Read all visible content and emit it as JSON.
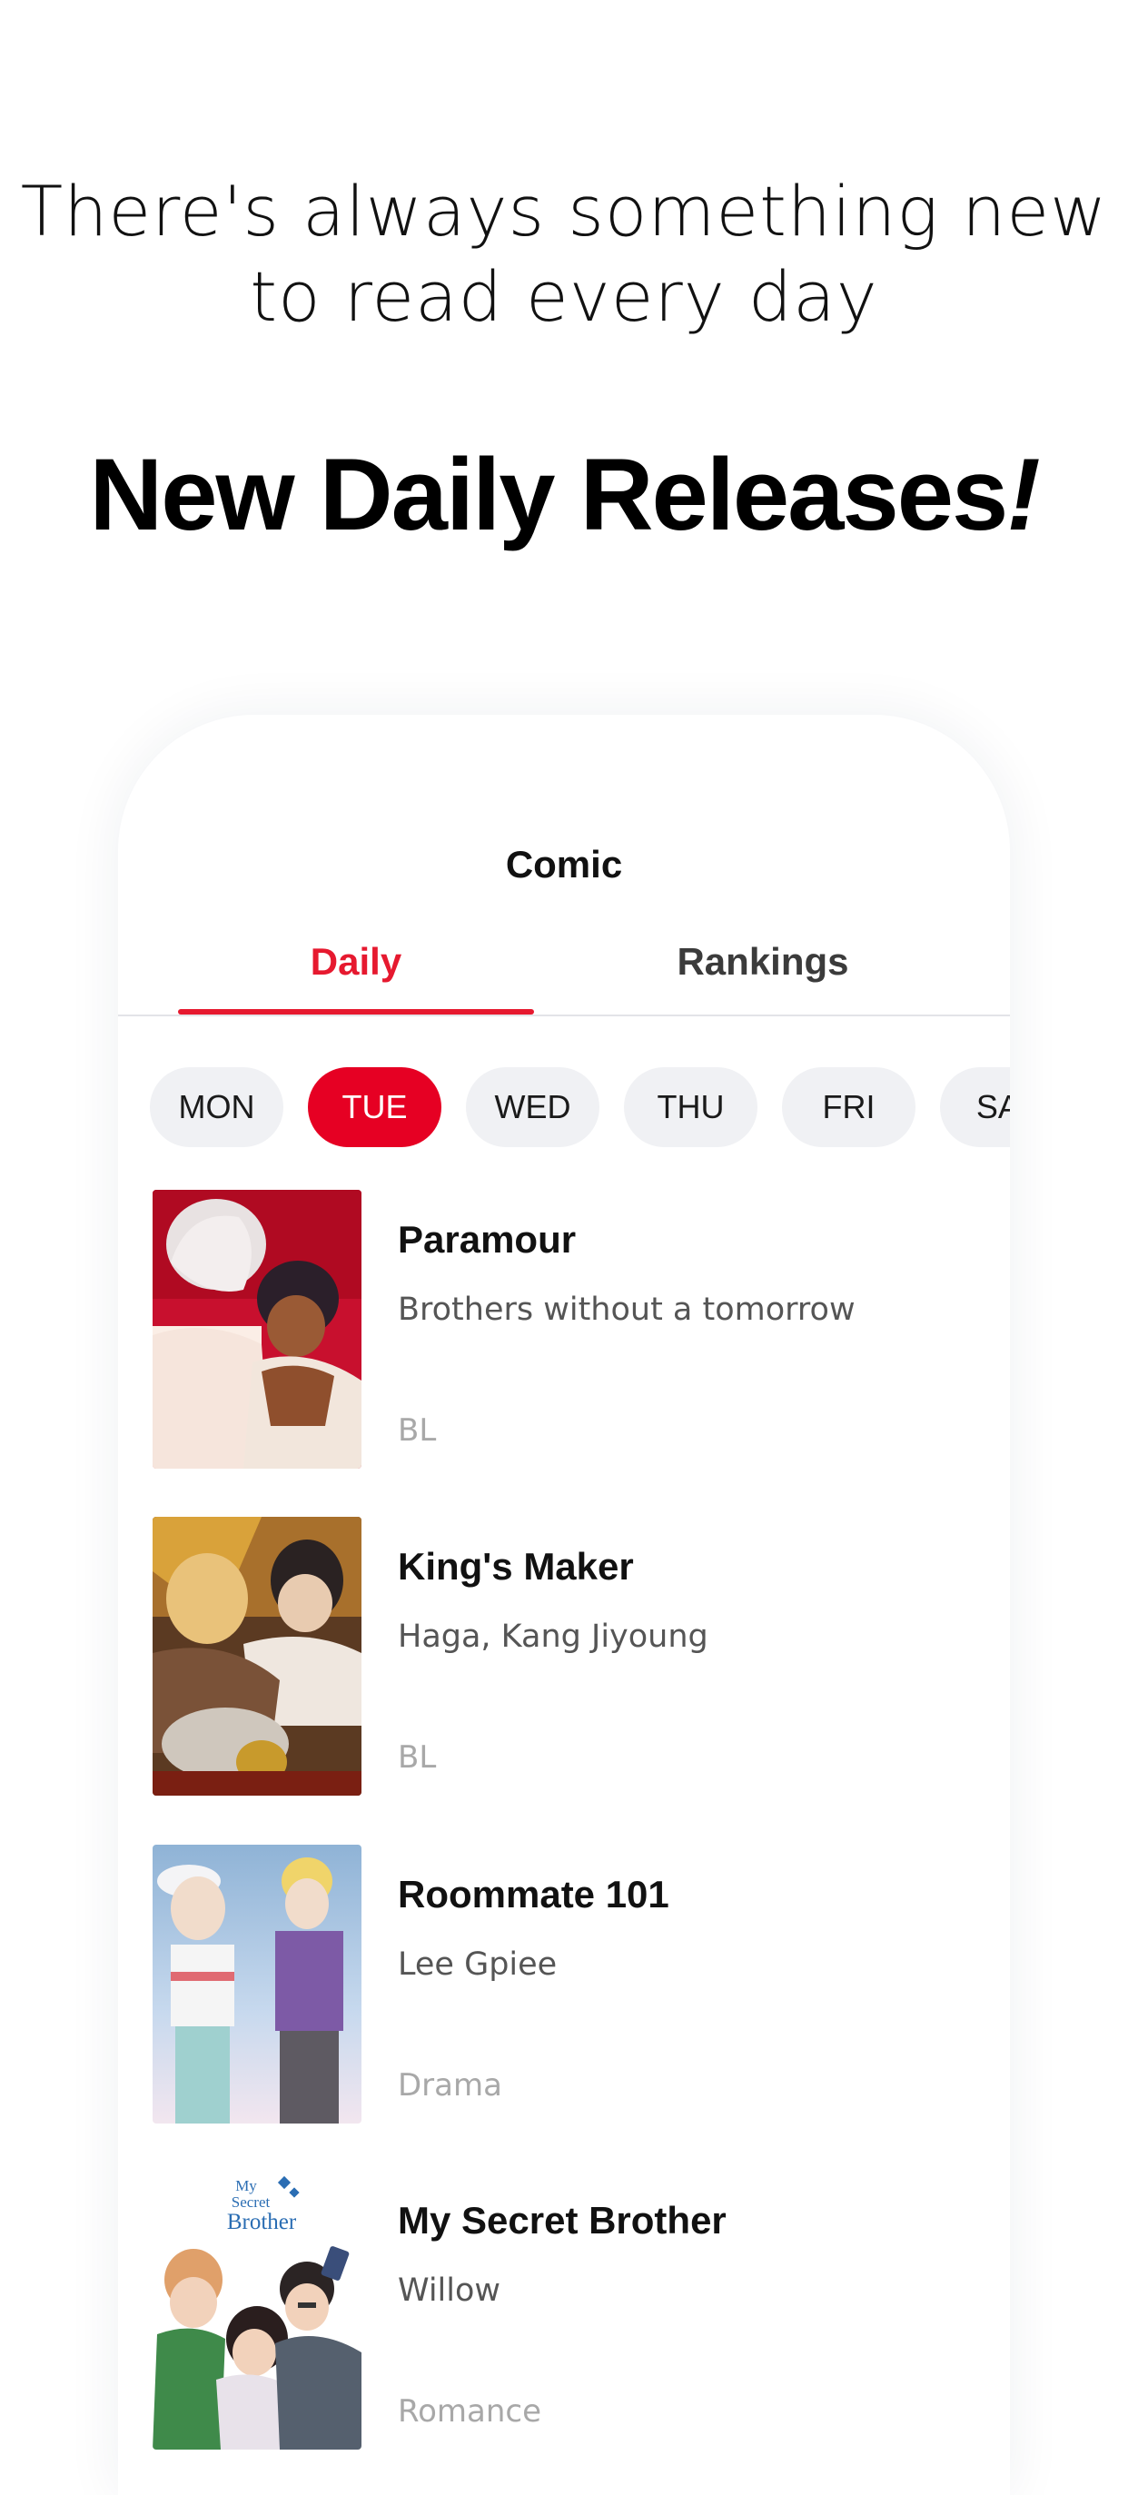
{
  "promo": {
    "subtitle": "There's always something new\nto read every day",
    "title_main": "New  Daily Releases",
    "title_bang": "!"
  },
  "screen": {
    "title": "Comic",
    "tabs": [
      {
        "label": "Daily",
        "active": true
      },
      {
        "label": "Rankings",
        "active": false
      }
    ],
    "days": [
      {
        "label": "MON",
        "active": false
      },
      {
        "label": "TUE",
        "active": true
      },
      {
        "label": "WED",
        "active": false
      },
      {
        "label": "THU",
        "active": false
      },
      {
        "label": "FRI",
        "active": false
      },
      {
        "label": "SAT",
        "active": false
      }
    ],
    "comics": [
      {
        "title": "Paramour",
        "author": "Brothers without a tomorrow",
        "genre": "BL",
        "cover_icon": "paramour-cover"
      },
      {
        "title": "King's Maker",
        "author": "Haga, Kang Jiyoung",
        "genre": "BL",
        "cover_icon": "kings-maker-cover"
      },
      {
        "title": "Roommate 101",
        "author": "Lee Gpiee",
        "genre": "Drama",
        "cover_icon": "roommate-101-cover"
      },
      {
        "title": "My Secret Brother",
        "author": "Willow",
        "genre": "Romance",
        "cover_icon": "my-secret-brother-cover",
        "cover_text": [
          "My",
          "Secret",
          "Brother"
        ]
      }
    ]
  },
  "colors": {
    "accent": "#e6192f",
    "active_day": "#e60023",
    "day_pill": "#f0f1f4",
    "genre_text": "#a8a8a8"
  }
}
